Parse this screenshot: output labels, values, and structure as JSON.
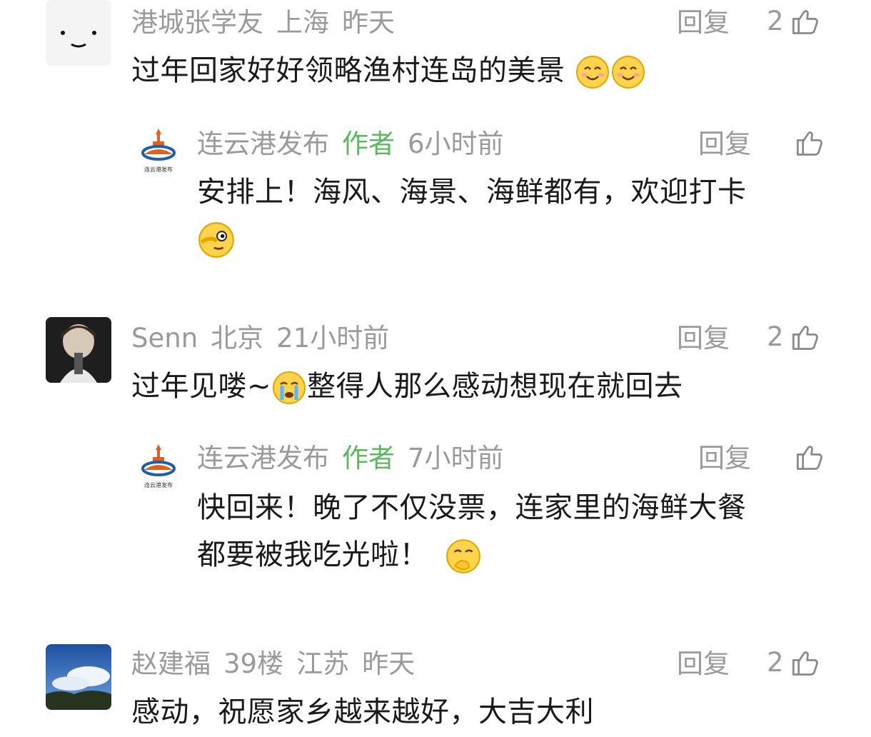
{
  "labels": {
    "reply": "回复",
    "author": "作者"
  },
  "comments": [
    {
      "user": "港城张学友",
      "location": "上海",
      "time": "昨天",
      "likes": "2",
      "text": "过年回家好好领略渔村连岛的美景",
      "reply": {
        "user": "连云港发布",
        "time": "6小时前",
        "line1": "安排上！海风、海景、海鲜都有，欢迎打卡",
        "line2": ""
      }
    },
    {
      "user": "Senn",
      "location": "北京",
      "time": "21小时前",
      "likes": "2",
      "text_a": "过年见喽~",
      "text_b": "整得人那么感动想现在就回去",
      "reply": {
        "user": "连云港发布",
        "time": "7小时前",
        "line1": "快回来！晚了不仅没票，连家里的海鲜大餐",
        "line2": "都要被我吃光啦！"
      }
    },
    {
      "user": "赵建福",
      "floor": "39楼",
      "location": "江苏",
      "time": "昨天",
      "likes": "2",
      "text": "感动，祝愿家乡越来越好，大吉大利"
    }
  ],
  "logo_text": "连云港发布",
  "colors": {
    "meta": "#9a9a9a",
    "author": "#5cb85c",
    "text": "#1a1a1a"
  }
}
